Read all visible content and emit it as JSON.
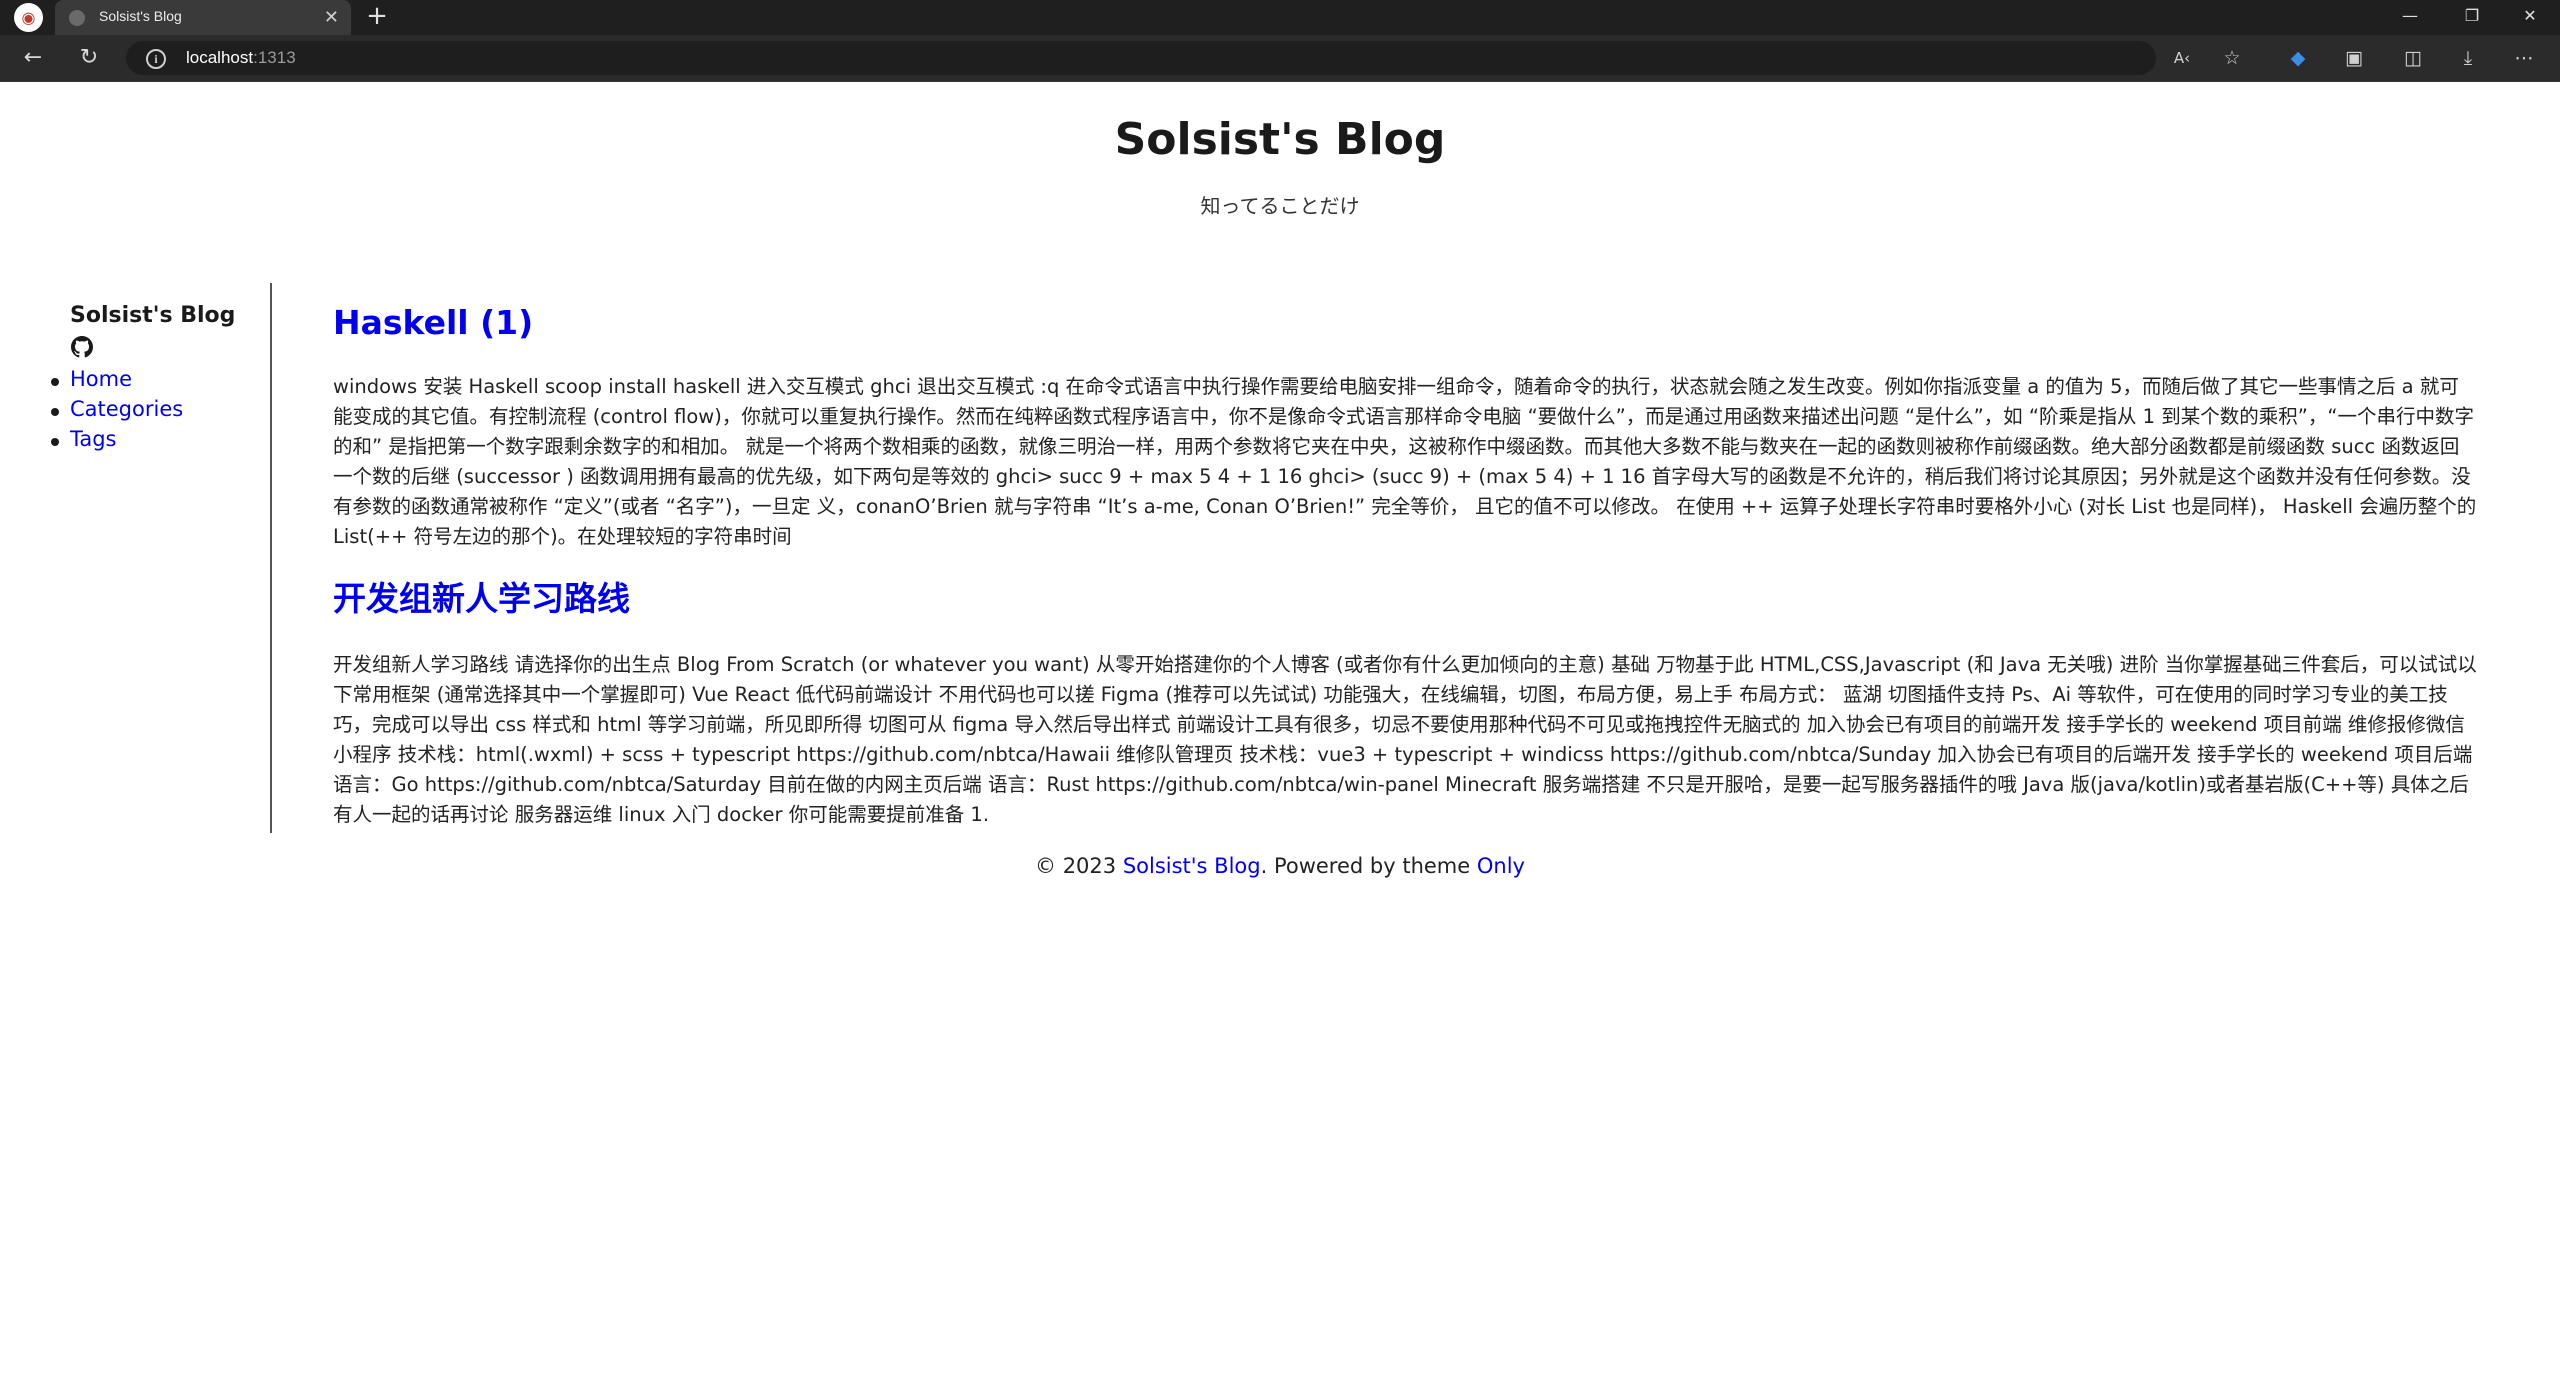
{
  "browser": {
    "tab_title": "Solsist's Blog",
    "url_host": "localhost",
    "url_port": ":1313",
    "icons": [
      "back-icon",
      "refresh-icon",
      "info-icon",
      "read-aloud-icon",
      "favorite-star-icon",
      "extension-shield-icon",
      "extension-icon",
      "split-screen-icon",
      "download-icon",
      "more-icon"
    ]
  },
  "header": {
    "title": "Solsist's Blog",
    "subtitle": "知ってることだけ"
  },
  "sidebar": {
    "title": "Solsist's Blog",
    "nav": [
      {
        "label": "Home"
      },
      {
        "label": "Categories"
      },
      {
        "label": "Tags"
      }
    ]
  },
  "posts": [
    {
      "title": "Haskell (1)",
      "excerpt": "windows 安装 Haskell scoop install haskell 进入交互模式 ghci 退出交互模式 :q 在命令式语言中执行操作需要给电脑安排一组命令，随着命令的执行，状态就会随之发生改变。例如你指派变量 a 的值为 5，而随后做了其它一些事情之后 a 就可能变成的其它值。有控制流程 (control flow)，你就可以重复执行操作。然而在纯粹函数式程序语言中，你不是像命令式语言那样命令电脑 “要做什么”，而是通过用函数来描述出问题 “是什么”，如 “阶乘是指从 1 到某个数的乘积”，“一个串行中数字的和” 是指把第一个数字跟剩余数字的和相加。 就是一个将两个数相乘的函数，就像三明治一样，用两个参数将它夹在中央，这被称作中缀函数。而其他大多数不能与数夹在一起的函数则被称作前缀函数。绝大部分函数都是前缀函数 succ 函数返回一个数的后继 (successor ) 函数调用拥有最高的优先级，如下两句是等效的 ghci> succ 9 + max 5 4 + 1 16 ghci> (succ 9) + (max 5 4) + 1 16 首字母大写的函数是不允许的，稍后我们将讨论其原因；另外就是这个函数并没有任何参数。没有参数的函数通常被称作 “定义”(或者 “名字”)，一旦定 义，conanO’Brien 就与字符串 “It’s a-me, Conan O’Brien!” 完全等价， 且它的值不可以修改。 在使用 ++ 运算子处理长字符串时要格外小心 (对长 List 也是同样)， Haskell 会遍历整个的 List(++ 符号左边的那个)。在处理较短的字符串时间"
    },
    {
      "title": "开发组新人学习路线",
      "excerpt": "开发组新人学习路线 请选择你的出生点 Blog From Scratch (or whatever you want) 从零开始搭建你的个人博客 (或者你有什么更加倾向的主意) 基础 万物基于此 HTML,CSS,Javascript (和 Java 无关哦) 进阶 当你掌握基础三件套后，可以试试以下常用框架 (通常选择其中一个掌握即可) Vue React 低代码前端设计 不用代码也可以搓 Figma (推荐可以先试试) 功能强大，在线编辑，切图，布局方便，易上手 布局方式： 蓝湖 切图插件支持 Ps、Ai 等软件，可在使用的同时学习专业的美工技巧，完成可以导出 css 样式和 html 等学习前端，所见即所得 切图可从 figma 导入然后导出样式 前端设计工具有很多，切忌不要使用那种代码不可见或拖拽控件无脑式的 加入协会已有项目的前端开发 接手学长的 weekend 项目前端 维修报修微信小程序 技术栈：html(.wxml) + scss + typescript https://github.com/nbtca/Hawaii 维修队管理页 技术栈：vue3 + typescript + windicss https://github.com/nbtca/Sunday 加入协会已有项目的后端开发 接手学长的 weekend 项目后端 语言：Go https://github.com/nbtca/Saturday 目前在做的内网主页后端 语言：Rust https://github.com/nbtca/win-panel Minecraft 服务端搭建 不只是开服哈，是要一起写服务器插件的哦 Java 版(java/kotlin)或者基岩版(C++等) 具体之后有人一起的话再讨论 服务器运维 linux 入门 docker 你可能需要提前准备 1."
    }
  ],
  "footer": {
    "copyright": "© 2023 ",
    "blog_link": "Solsist's Blog",
    "powered_by": ". Powered by theme ",
    "theme_link": "Only"
  }
}
